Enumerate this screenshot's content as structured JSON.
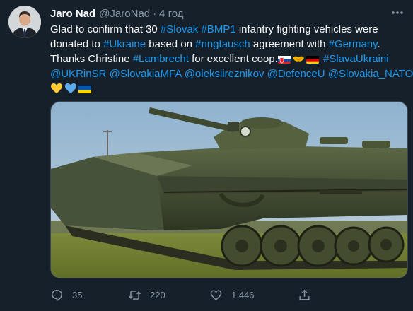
{
  "author": {
    "name": "Jaro Nad",
    "handle": "@JaroNad",
    "separator": "·",
    "time": "4 год"
  },
  "tweet": {
    "line1": [
      {
        "text": "Glad to confirm that 30 ",
        "tag": false
      },
      {
        "text": "#Slovak",
        "tag": true
      },
      {
        "text": " ",
        "tag": false
      },
      {
        "text": "#BMP1",
        "tag": true
      },
      {
        "text": " infantry fighting vehicles were",
        "tag": false
      }
    ],
    "line2": [
      {
        "text": "donated to ",
        "tag": false
      },
      {
        "text": "#Ukraine",
        "tag": true
      },
      {
        "text": " based on ",
        "tag": false
      },
      {
        "text": "#ringtausch",
        "tag": true
      },
      {
        "text": " agreement with ",
        "tag": false
      },
      {
        "text": "#Germany",
        "tag": true
      },
      {
        "text": ".",
        "tag": false
      }
    ],
    "line3_a": [
      {
        "text": "Thanks Christine ",
        "tag": false
      },
      {
        "text": "#Lambrecht",
        "tag": true
      },
      {
        "text": " for excellent coop.",
        "tag": false
      }
    ],
    "line3_b": [
      {
        "text": "#SlavaUkraini",
        "tag": true
      }
    ],
    "line4": [
      {
        "text": "@UKRinSR",
        "tag": true
      },
      {
        "text": " ",
        "tag": false
      },
      {
        "text": "@SlovakiaMFA",
        "tag": true
      },
      {
        "text": " ",
        "tag": false
      },
      {
        "text": "@oleksiireznikov",
        "tag": true
      },
      {
        "text": " ",
        "tag": false
      },
      {
        "text": "@DefenceU",
        "tag": true
      },
      {
        "text": " ",
        "tag": false
      },
      {
        "text": "@Slovakia_NATO",
        "tag": true
      }
    ],
    "emojis_line3": [
      "slovakia-flag",
      "handshake",
      "germany-flag"
    ],
    "emojis_line5": [
      "yellow-heart",
      "blue-heart",
      "ukraine-flag"
    ]
  },
  "media": {
    "subject": "BMP-1 infantry fighting vehicle on grass"
  },
  "actions": {
    "replies": "35",
    "retweets": "220",
    "likes": "1 446"
  },
  "colors": {
    "background": "#15202b",
    "text": "#f7f9f9",
    "muted": "#8b98a5",
    "link": "#1d9bf0"
  }
}
